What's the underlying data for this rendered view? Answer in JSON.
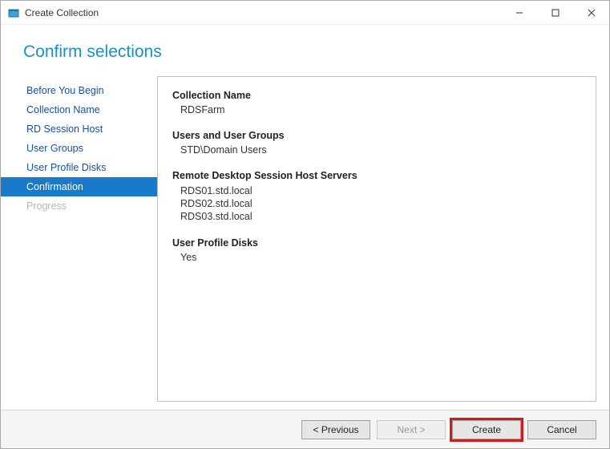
{
  "window": {
    "title": "Create Collection"
  },
  "heading": "Confirm selections",
  "sidebar": {
    "steps": [
      "Before You Begin",
      "Collection Name",
      "RD Session Host",
      "User Groups",
      "User Profile Disks",
      "Confirmation",
      "Progress"
    ]
  },
  "content": {
    "collection_name_label": "Collection Name",
    "collection_name_value": "RDSFarm",
    "users_label": "Users and User Groups",
    "users_value": "STD\\Domain Users",
    "hosts_label": "Remote Desktop Session Host Servers",
    "hosts": [
      "RDS01.std.local",
      "RDS02.std.local",
      "RDS03.std.local"
    ],
    "upd_label": "User Profile Disks",
    "upd_value": "Yes"
  },
  "footer": {
    "previous": "< Previous",
    "next": "Next >",
    "create": "Create",
    "cancel": "Cancel"
  }
}
